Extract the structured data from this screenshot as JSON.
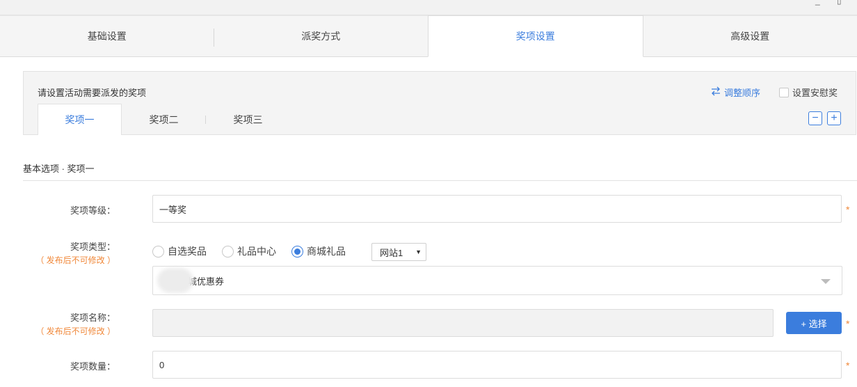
{
  "window": {
    "minimize_glyph": "_",
    "restore_glyph": "▯"
  },
  "main_tabs": [
    {
      "label": "基础设置",
      "active": false
    },
    {
      "label": "派奖方式",
      "active": false
    },
    {
      "label": "奖项设置",
      "active": true
    },
    {
      "label": "高级设置",
      "active": false
    }
  ],
  "prize_panel": {
    "title": "请设置活动需要派发的奖项",
    "reorder_label": "调整顺序",
    "consolation_label": "设置安慰奖",
    "tabs": [
      {
        "label": "奖项一",
        "active": true
      },
      {
        "label": "奖项二",
        "active": false
      },
      {
        "label": "奖项三",
        "active": false
      }
    ],
    "remove_glyph": "−",
    "add_glyph": "+"
  },
  "section": {
    "title": "基本选项 · 奖项一"
  },
  "form": {
    "level_label": "奖项等级：",
    "level_value": "一等奖",
    "type_label": "奖项类型：",
    "type_note": "（ 发布后不可修改 ）",
    "type_options": [
      {
        "label": "自选奖品",
        "checked": false
      },
      {
        "label": "礼品中心",
        "checked": false
      },
      {
        "label": "商城礼品",
        "checked": true
      }
    ],
    "site_select": "网站1",
    "coupon_select": "城优惠券",
    "name_label": "奖项名称：",
    "name_note": "（ 发布后不可修改 ）",
    "name_value": "",
    "choose_button": "+ 选择",
    "qty_label": "奖项数量：",
    "qty_value": "0",
    "required_mark": "*"
  },
  "colors": {
    "accent": "#3b7ddd",
    "warning": "#f0883a"
  }
}
